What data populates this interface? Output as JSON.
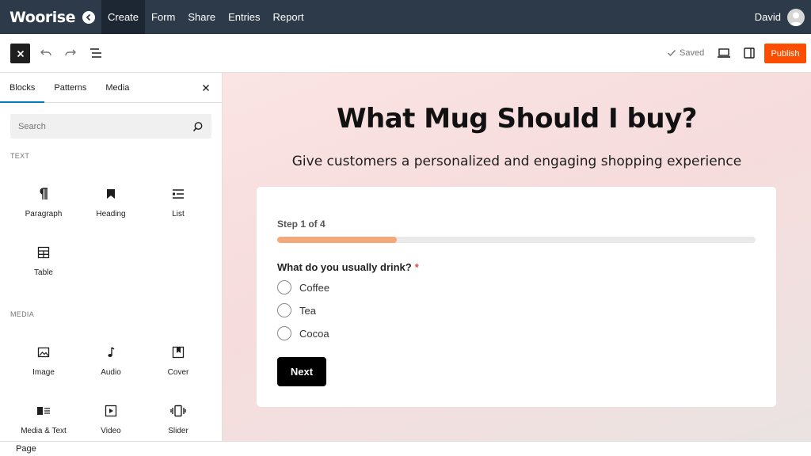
{
  "topnav": {
    "logo": "Woorise",
    "links": [
      {
        "label": "Create",
        "active": true
      },
      {
        "label": "Form",
        "active": false
      },
      {
        "label": "Share",
        "active": false
      },
      {
        "label": "Entries",
        "active": false
      },
      {
        "label": "Report",
        "active": false
      }
    ],
    "user": "David"
  },
  "toolbar": {
    "saved_label": "Saved",
    "publish_label": "Publish"
  },
  "sidebar": {
    "tabs": [
      "Blocks",
      "Patterns",
      "Media"
    ],
    "search_placeholder": "Search",
    "sections": [
      {
        "label": "TEXT",
        "blocks": [
          {
            "label": "Paragraph",
            "icon": "paragraph-icon"
          },
          {
            "label": "Heading",
            "icon": "heading-icon"
          },
          {
            "label": "List",
            "icon": "list-icon"
          },
          {
            "label": "Table",
            "icon": "table-icon"
          }
        ]
      },
      {
        "label": "MEDIA",
        "blocks": [
          {
            "label": "Image",
            "icon": "image-icon"
          },
          {
            "label": "Audio",
            "icon": "audio-icon"
          },
          {
            "label": "Cover",
            "icon": "cover-icon"
          },
          {
            "label": "Media & Text",
            "icon": "media-text-icon"
          },
          {
            "label": "Video",
            "icon": "video-icon"
          },
          {
            "label": "Slider",
            "icon": "slider-icon"
          }
        ]
      }
    ]
  },
  "statusbar": {
    "label": "Page"
  },
  "form": {
    "title": "What Mug Should I buy?",
    "subtitle": "Give customers a personalized and engaging shopping experience",
    "step_label": "Step 1 of 4",
    "progress": 0.25,
    "question": "What do you usually drink?",
    "required_mark": "*",
    "options": [
      "Coffee",
      "Tea",
      "Cocoa"
    ],
    "next_label": "Next"
  },
  "colors": {
    "nav_bg": "#2c3a4a",
    "publish": "#ff4d00",
    "progress_fill": "#f4a97a",
    "tab_accent": "#007cba"
  }
}
